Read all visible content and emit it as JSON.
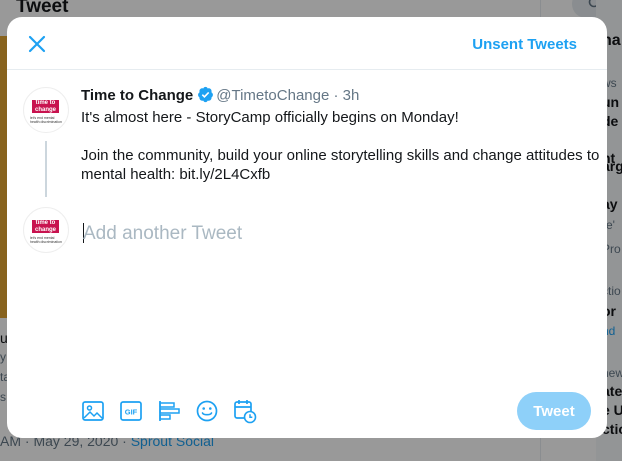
{
  "background": {
    "title": "Tweet",
    "left_fragments": [
      "u",
      "y",
      "ta",
      "s"
    ],
    "meta_text": "AM · May 29, 2020 · ",
    "meta_source": "Sprout Social",
    "right_fragments": [
      "ha",
      "ws",
      "un",
      "de",
      "t",
      "nt",
      "arg",
      "ay",
      "re'",
      "Pro",
      "ctio",
      "or",
      "nd",
      "new",
      "ate",
      "e U",
      "ctio"
    ]
  },
  "modal": {
    "unsent_label": "Unsent Tweets",
    "tweet": {
      "author_name": "Time to Change",
      "handle": "@TimetoChange",
      "separator": "·",
      "time": "3h",
      "paragraphs": [
        "It's almost here - StoryCamp officially begins on Monday!",
        "Join the community, build your online storytelling skills and change attitudes to mental health: bit.ly/2L4Cxfb"
      ]
    },
    "avatar": {
      "logo_line1": "time to",
      "logo_line2": "change",
      "tagline": "let's end mental health discrimination"
    },
    "compose": {
      "placeholder": "Add another Tweet"
    },
    "toolbar": {
      "icons": [
        "image-icon",
        "gif-icon",
        "poll-icon",
        "emoji-icon",
        "schedule-icon"
      ],
      "gif_label": "GIF"
    },
    "tweet_button_label": "Tweet"
  },
  "colors": {
    "accent": "#1da1f2",
    "tweet_button_disabled": "#8ed0f9",
    "brand_logo": "#c8134f"
  }
}
